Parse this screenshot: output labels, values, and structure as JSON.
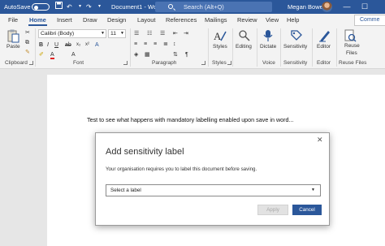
{
  "titlebar": {
    "autosave_label": "AutoSave",
    "toggle_state": "Off",
    "doc_title": "Document1 - Word",
    "search_placeholder": "Search (Alt+Q)",
    "user_name": "Megan Bowen",
    "minimize": "—",
    "maximize": "☐"
  },
  "tabs": [
    "File",
    "Home",
    "Insert",
    "Draw",
    "Design",
    "Layout",
    "References",
    "Mailings",
    "Review",
    "View",
    "Help"
  ],
  "active_tab": "Home",
  "comments_label": "Comme",
  "ribbon": {
    "clipboard": {
      "paste_label": "Paste",
      "group_label": "Clipboard"
    },
    "font": {
      "font_name": "Calibri (Body)",
      "font_size": "11",
      "group_label": "Font"
    },
    "paragraph": {
      "group_label": "Paragraph"
    },
    "styles": {
      "styles_label": "Styles",
      "group_label": "Styles"
    },
    "editing": {
      "editing_label": "Editing"
    },
    "voice": {
      "dictate_label": "Dictate",
      "group_label": "Voice"
    },
    "sensitivity": {
      "sensitivity_label": "Sensitivity",
      "group_label": "Sensitivity"
    },
    "editor": {
      "editor_label": "Editor",
      "group_label": "Editor"
    },
    "reuse": {
      "reuse_label_line1": "Reuse",
      "reuse_label_line2": "Files",
      "group_label": "Reuse Files"
    }
  },
  "document": {
    "body_text": "Test to see what happens with mandatory labelling enabled upon save in word..."
  },
  "dialog": {
    "title": "Add sensitivity label",
    "close": "✕",
    "message": "Your organisation requires you to label this document before saving.",
    "select_value": "Select a label",
    "apply_label": "Apply",
    "cancel_label": "Cancel"
  },
  "colors": {
    "brand": "#2b579a",
    "ribbon_bg": "#f3f3f3",
    "canvas_bg": "#e6e6e6"
  }
}
